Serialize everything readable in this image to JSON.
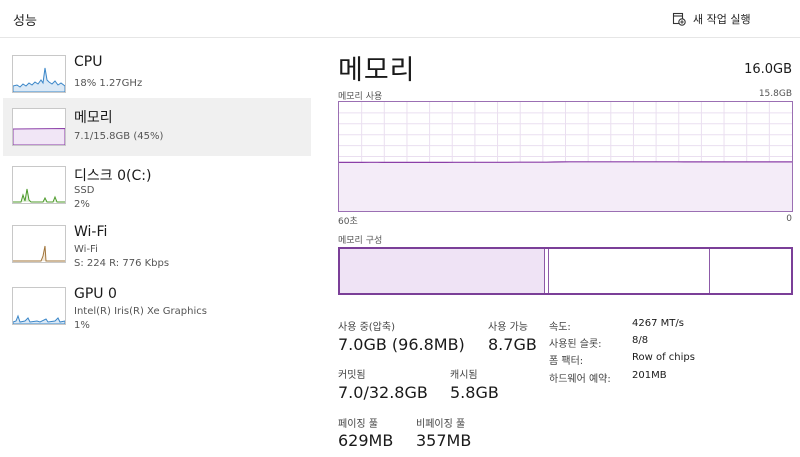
{
  "header": {
    "title": "성능",
    "run_task_label": "새 작업 실행"
  },
  "sidebar": {
    "items": [
      {
        "name": "CPU",
        "line1": "18%  1.27GHz",
        "line2": "",
        "line3": "",
        "color": "#3a86c8"
      },
      {
        "name": "메모리",
        "line1": "7.1/15.8GB (45%)",
        "line2": "",
        "line3": "",
        "color": "#8b3fa8",
        "selected": true
      },
      {
        "name": "디스크 0(C:)",
        "line1": "SSD",
        "line2": "2%",
        "line3": "",
        "color": "#4c9a2a"
      },
      {
        "name": "Wi-Fi",
        "line1": "Wi-Fi",
        "line2": "S: 224  R: 776 Kbps",
        "line3": "",
        "color": "#a0743a"
      },
      {
        "name": "GPU 0",
        "line1": "Intel(R) Iris(R) Xe Graphics",
        "line2": "1%",
        "line3": "",
        "color": "#3a86c8"
      }
    ]
  },
  "main": {
    "title": "메모리",
    "total": "16.0GB",
    "usage_label": "메모리 사용",
    "usage_max": "15.8GB",
    "time_left": "60초",
    "time_right": "0",
    "composition_label": "메모리 구성",
    "stats": {
      "in_use_label": "사용 중(압축)",
      "in_use_value": "7.0GB (96.8MB)",
      "available_label": "사용 가능",
      "available_value": "8.7GB",
      "committed_label": "커밋됨",
      "committed_value": "7.0/32.8GB",
      "cached_label": "캐시됨",
      "cached_value": "5.8GB",
      "paged_label": "페이징 풀",
      "paged_value": "629MB",
      "nonpaged_label": "비페이징 풀",
      "nonpaged_value": "357MB"
    },
    "details": [
      {
        "key": "속도:",
        "value": "4267 MT/s"
      },
      {
        "key": "사용된 슬롯:",
        "value": "8/8"
      },
      {
        "key": "폼 팩터:",
        "value": "Row of chips"
      },
      {
        "key": "하드웨어 예약:",
        "value": "201MB"
      }
    ]
  },
  "chart_data": {
    "type": "area",
    "title": "메모리 사용",
    "xlabel": "",
    "ylabel": "",
    "x_range": [
      60,
      0
    ],
    "ylim": [
      0,
      15.8
    ],
    "series": [
      {
        "values": [
          7.05,
          7.05,
          7.05,
          7.05,
          7.06,
          7.06,
          7.05,
          7.05,
          7.04,
          7.05,
          7.05,
          7.05,
          7.05,
          7.05,
          7.05,
          7.06,
          7.06,
          7.06,
          7.06,
          7.06,
          7.06,
          7.06,
          7.06,
          7.07,
          7.07,
          7.07,
          7.08,
          7.08,
          7.1,
          7.12,
          7.13,
          7.13,
          7.13,
          7.13,
          7.13,
          7.13,
          7.13,
          7.13,
          7.13,
          7.13,
          7.13,
          7.13,
          7.13,
          7.13,
          7.13,
          7.12,
          7.12,
          7.12,
          7.12,
          7.12,
          7.12,
          7.12,
          7.12,
          7.12,
          7.12,
          7.12,
          7.12,
          7.12,
          7.12,
          7.12
        ]
      }
    ],
    "grid": true,
    "color": "#8b3fa8"
  }
}
